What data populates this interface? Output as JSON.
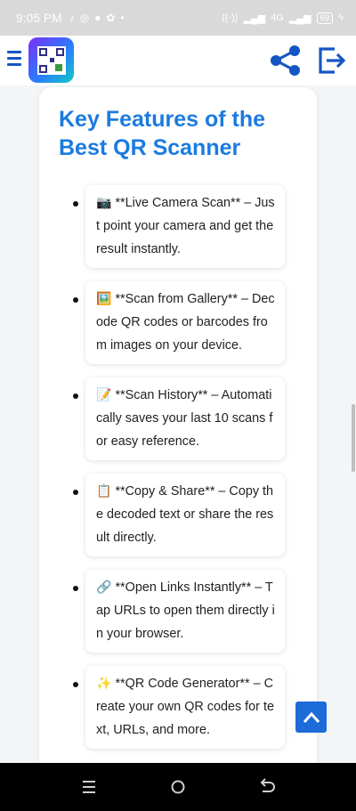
{
  "status_bar": {
    "time": "9:05 PM",
    "left_icons": [
      "tiktok-icon",
      "whatsapp-icon",
      "chat-icon",
      "app-icon",
      "dot"
    ],
    "right_text": "4G",
    "battery": "69"
  },
  "header": {
    "logo_icon": "qr-code-logo",
    "menu_icon": "hamburger-icon",
    "share_icon": "share-icon",
    "exit_icon": "exit-icon",
    "accent": "#1556c4"
  },
  "card": {
    "title": "Key Features of the Best QR Scanner",
    "title_color": "#1a7be0",
    "features": [
      {
        "emoji": "📷",
        "text": "**Live Camera Scan** – Just point your camera and get the result instantly."
      },
      {
        "emoji": "🖼️",
        "text": "**Scan from Gallery** – Decode QR codes or barcodes from images on your device."
      },
      {
        "emoji": "📝",
        "text": "**Scan History** – Automatically saves your last 10 scans for easy reference."
      },
      {
        "emoji": "📋",
        "text": "**Copy & Share** – Copy the decoded text or share the result directly."
      },
      {
        "emoji": "🔗",
        "text": "**Open Links Instantly** – Tap URLs to open them directly in your browser."
      },
      {
        "emoji": "✨",
        "text": "**QR Code Generator** – Create your own QR codes for text, URLs, and more."
      }
    ]
  },
  "scroll_top_icon": "chevron-up-icon",
  "nav_bar": {
    "recent_icon": "recent-apps-icon",
    "home_icon": "home-icon",
    "back_icon": "back-icon"
  }
}
